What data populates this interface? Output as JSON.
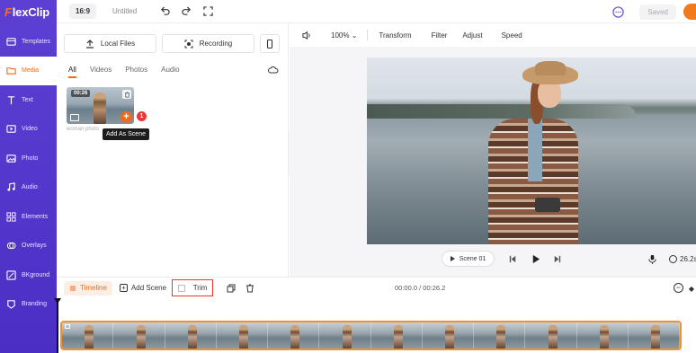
{
  "app": {
    "logo_text": "FlexClip",
    "logo_f": "F",
    "logo_rest": "lexClip"
  },
  "topbar": {
    "ratio": "16:9",
    "project_name": "Untitled",
    "saved": "Saved",
    "icons": [
      "undo-icon",
      "redo-icon",
      "fullscreen-icon",
      "chat-icon"
    ]
  },
  "sidebar": {
    "items": [
      {
        "label": "Templates",
        "icon": "templates-icon"
      },
      {
        "label": "Media",
        "icon": "folder-icon",
        "active": true
      },
      {
        "label": "Text",
        "icon": "text-icon"
      },
      {
        "label": "Video",
        "icon": "video-icon"
      },
      {
        "label": "Photo",
        "icon": "photo-icon"
      },
      {
        "label": "Audio",
        "icon": "music-icon"
      },
      {
        "label": "Elements",
        "icon": "elements-icon"
      },
      {
        "label": "Overlays",
        "icon": "overlays-icon"
      },
      {
        "label": "BKground",
        "icon": "background-icon"
      },
      {
        "label": "Branding",
        "icon": "branding-icon"
      }
    ]
  },
  "media": {
    "local_files": "Local Files",
    "recording": "Recording",
    "tabs": [
      "All",
      "Videos",
      "Photos",
      "Audio"
    ],
    "active_tab": "All",
    "item": {
      "duration": "00:26",
      "caption": "woman photo",
      "badge": "1"
    },
    "tooltip": "Add As Scene"
  },
  "preview": {
    "zoom": "100%",
    "tools": [
      "Transform",
      "Filter",
      "Adjust",
      "Speed"
    ],
    "scene_label": "Scene 01",
    "time": "26.2s"
  },
  "timeline": {
    "timeline_label": "Timeline",
    "add_scene": "Add Scene",
    "trim": "Trim",
    "time": "00:00.0 / 00:26.2",
    "frames": 12
  },
  "colors": {
    "sidebar": "#5d3fd3",
    "accent": "#f06a1c",
    "trim_highlight": "#e53935",
    "strip_border": "#f0922c"
  }
}
